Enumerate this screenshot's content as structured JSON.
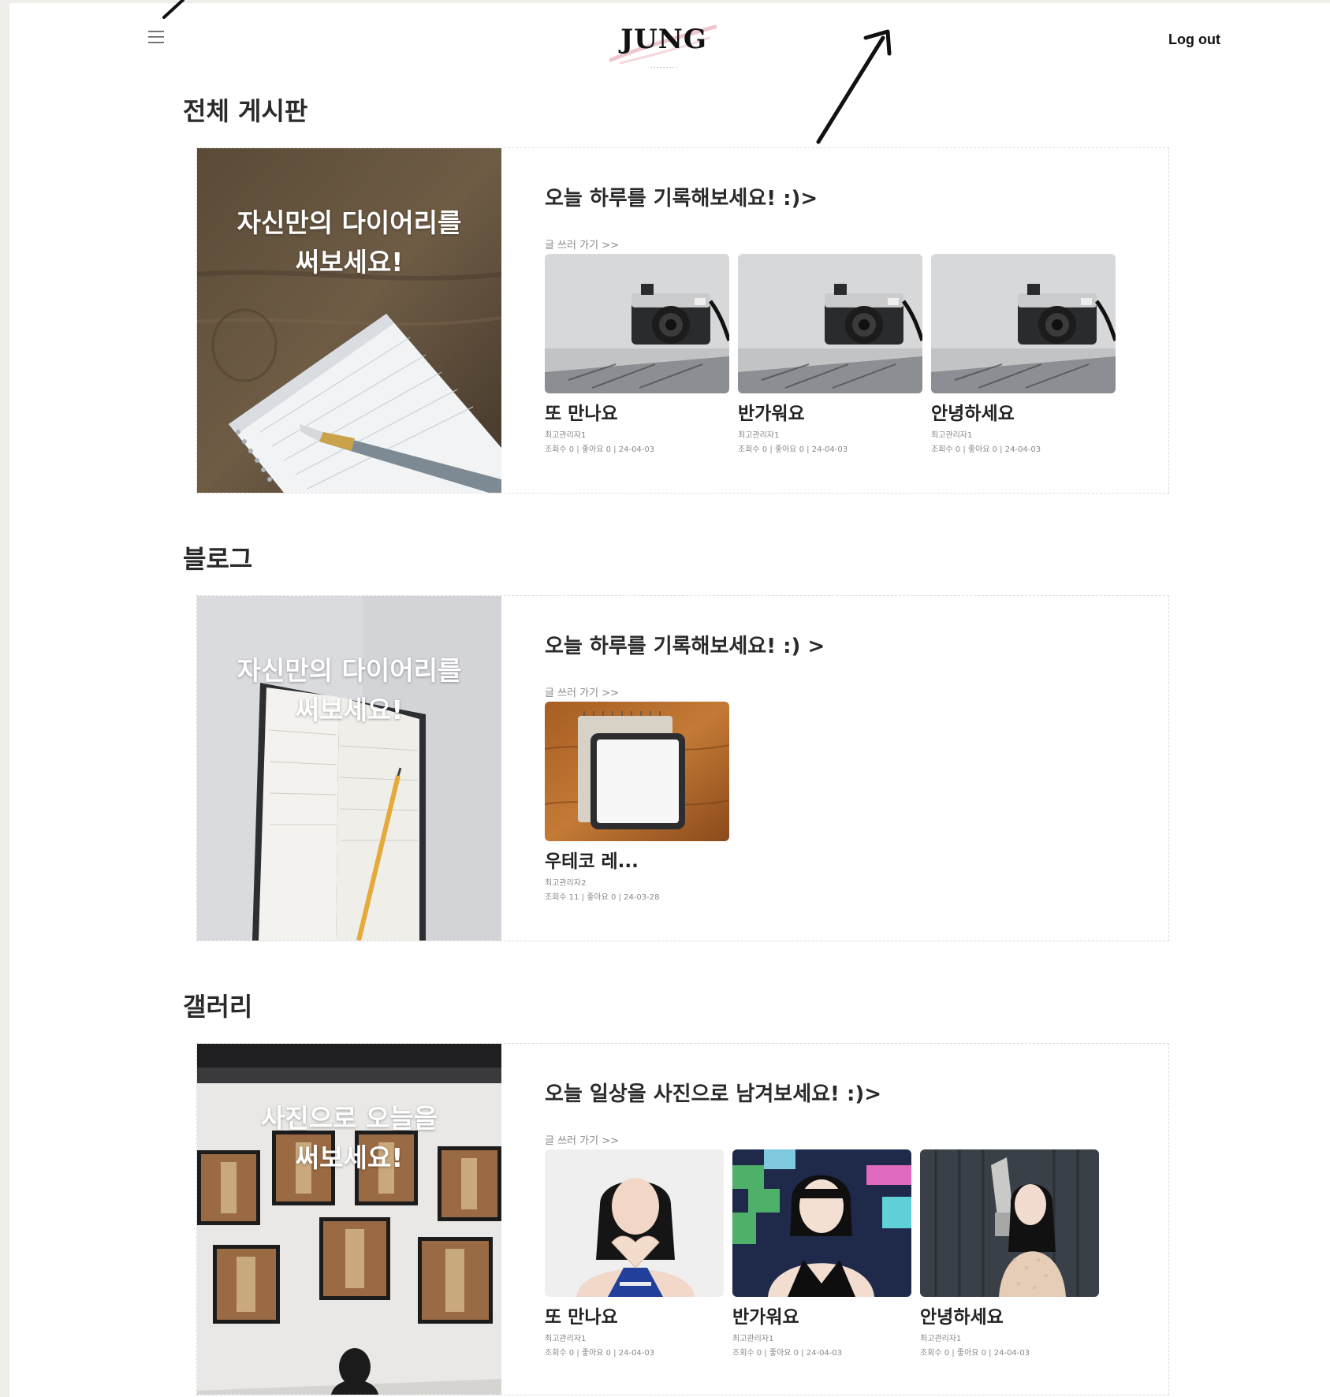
{
  "header": {
    "logo_text": "JUNG",
    "logout_label": "Log out",
    "menu_icon": "hamburger-icon"
  },
  "colors": {
    "background": "#efeeea",
    "page": "#ffffff",
    "text": "#222222",
    "muted": "#888888",
    "logo_brush": "#e7b4bd"
  },
  "sections": [
    {
      "title": "전체 게시판",
      "banner_text_line1": "자신만의 다이어리를",
      "banner_text_line2": "써보세요!",
      "heading": "오늘 하루를 기록해보세요! :)>",
      "write_link": "글 쓰러 가기 >>",
      "posts": [
        {
          "title": "또 만나요",
          "author": "최고관리자1",
          "meta": "조회수 0 | 좋아요 0 | 24-04-03"
        },
        {
          "title": "반가워요",
          "author": "최고관리자1",
          "meta": "조회수 0 | 좋아요 0 | 24-04-03"
        },
        {
          "title": "안녕하세요",
          "author": "최고관리자1",
          "meta": "조회수 0 | 좋아요 0 | 24-04-03"
        }
      ]
    },
    {
      "title": "블로그",
      "banner_text_line1": "자신만의 다이어리를",
      "banner_text_line2": "써보세요!",
      "heading": "오늘 하루를 기록해보세요! :) >",
      "write_link": "글 쓰러 가기 >>",
      "posts": [
        {
          "title": "우테코 레...",
          "author": "최고관리자2",
          "meta": "조회수 11 | 좋아요 0 | 24-03-28"
        }
      ]
    },
    {
      "title": "갤러리",
      "banner_text_line1": "사진으로 오늘을",
      "banner_text_line2": "써보세요!",
      "heading": "오늘 일상을 사진으로 남겨보세요! :)>",
      "write_link": "글 쓰러 가기 >>",
      "posts": [
        {
          "title": "또 만나요",
          "author": "최고관리자1",
          "meta": "조회수 0 | 좋아요 0 | 24-04-03"
        },
        {
          "title": "반가워요",
          "author": "최고관리자1",
          "meta": "조회수 0 | 좋아요 0 | 24-04-03"
        },
        {
          "title": "안녕하세요",
          "author": "최고관리자1",
          "meta": "조회수 0 | 좋아요 0 | 24-04-03"
        }
      ]
    }
  ]
}
